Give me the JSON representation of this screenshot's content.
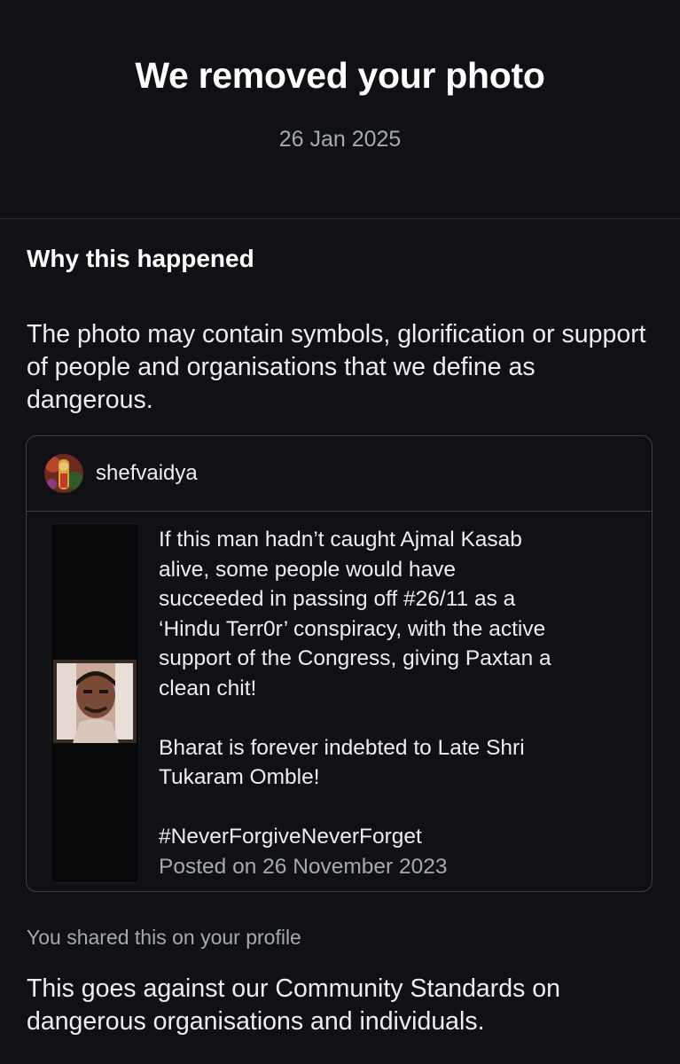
{
  "header": {
    "title": "We removed your photo",
    "date": "26 Jan 2025"
  },
  "reason": {
    "heading": "Why this happened",
    "text": "The photo may contain symbols, glorification or support of people and organisations that we define as dangerous."
  },
  "post": {
    "username": "shefvaidya",
    "paragraph1_lines": [
      "If this man hadn’t caught Ajmal Kasab",
      "alive, some people would have",
      "succeeded in passing off #26/11 as a",
      "‘Hindu Terr0r’ conspiracy, with the active",
      "support of the Congress, giving Paxtan a",
      "clean chit!"
    ],
    "paragraph2_lines": [
      "Bharat is forever indebted to Late Shri",
      "Tukaram Omble!"
    ],
    "hashtag": "#NeverForgiveNeverForget",
    "posted": "Posted on 26 November 2023"
  },
  "footer": {
    "shared_note": "You shared this on your profile",
    "standards_text": "This goes against our Community Standards on dangerous organisations and individuals."
  }
}
